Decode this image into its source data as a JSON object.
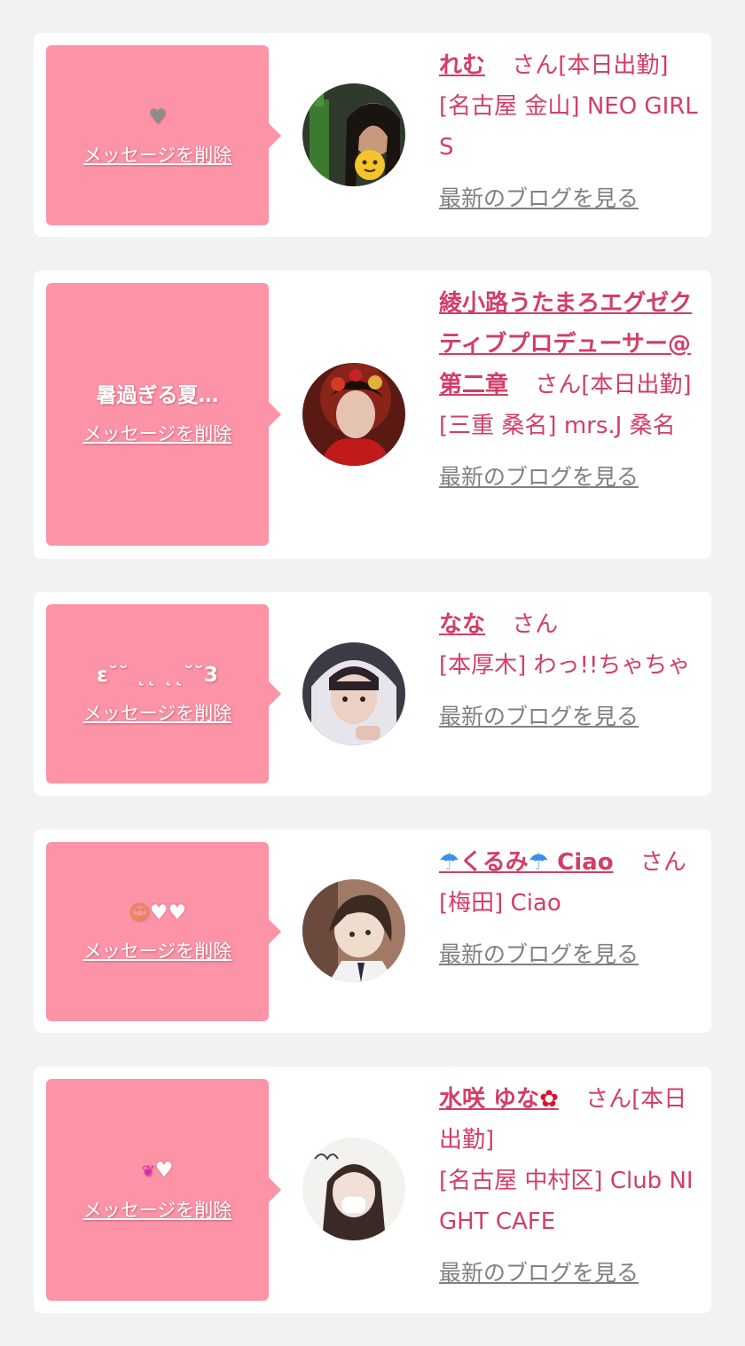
{
  "items": [
    {
      "message": "🩶",
      "delete_label": "メッセージを削除",
      "name": "れむ",
      "name_suffix": "さん[本日出勤]",
      "shop": "[名古屋 金山] NEO GIRLS",
      "blog_label": "最新のブログを見る"
    },
    {
      "message": "暑過ぎる夏…",
      "delete_label": "メッセージを削除",
      "name": "綾小路うたまろエグゼクティブプロデューサー@第二章",
      "name_suffix": "さん[本日出勤]",
      "shop": "[三重 桑名] mrs.J 桑名",
      "blog_label": "最新のブログを見る"
    },
    {
      "message": "ε˘˘ ˛˛ ˛˛˘˘3",
      "delete_label": "メッセージを削除",
      "name": "なな",
      "name_suffix": "さん",
      "shop": "[本厚木] わっ!!ちゃちゃ",
      "blog_label": "最新のブログを見る"
    },
    {
      "message": "😊🤍🤍",
      "delete_label": "メッセージを削除",
      "name_parts": [
        "🌈",
        "くるみ",
        "🌈",
        " Ciao"
      ],
      "name_suffix": "さん",
      "shop": "[梅田] Ciao",
      "blog_label": "最新のブログを見る"
    },
    {
      "message": "💞🤍",
      "delete_label": "メッセージを削除",
      "name": "水咲 ゆな",
      "name_emoji": "✿",
      "name_suffix": "さん[本日出勤]",
      "shop": "[名古屋 中村区] Club NIGHT CAFE",
      "blog_label": "最新のブログを見る"
    }
  ],
  "colors": {
    "background": "#f2f2f2",
    "card": "#ffffff",
    "bubble": "#fd93a6",
    "name_text": "#d23e66",
    "blog_link": "#808080"
  }
}
